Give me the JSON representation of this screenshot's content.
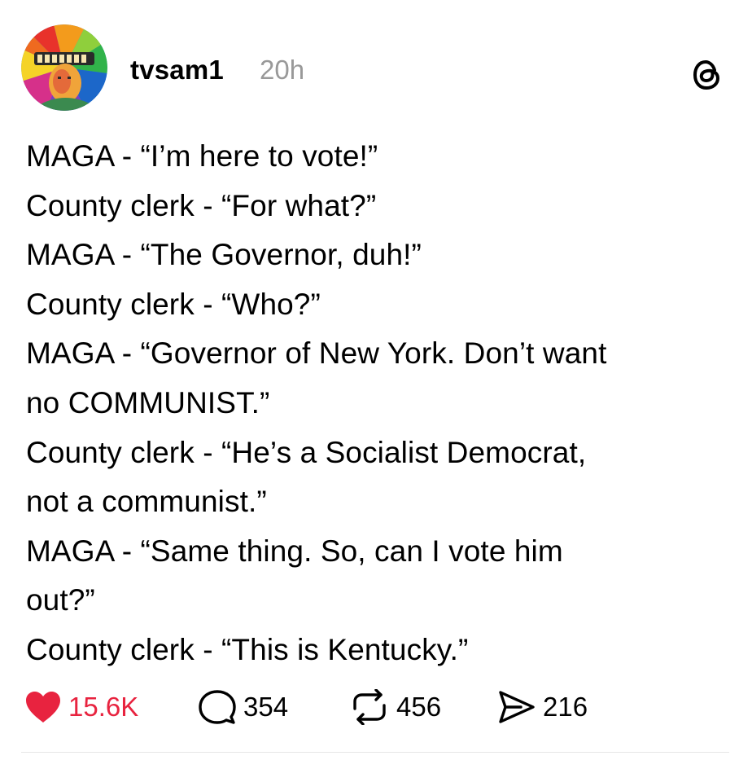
{
  "post": {
    "username": "tvsam1",
    "timestamp": "20h",
    "lines": [
      "MAGA - “I’m here to vote!”",
      "County clerk - “For what?”",
      "MAGA - “The Governor, duh!”",
      "County clerk - “Who?”",
      "MAGA - “Governor of New York. Don’t want",
      "no COMMUNIST.”",
      "County clerk - “He’s a Socialist Democrat,",
      "not a communist.”",
      "MAGA - “Same thing. So, can I vote him",
      "out?”",
      "County clerk - “This is Kentucky.”"
    ]
  },
  "actions": {
    "likes": "15.6K",
    "replies": "354",
    "reposts": "456",
    "shares": "216"
  },
  "icons": {
    "like": "heart-icon",
    "reply": "comment-bubble-icon",
    "repost": "repost-icon",
    "share": "send-icon",
    "brand": "threads-logo-icon"
  },
  "colors": {
    "like": "#e8233f",
    "timestamp": "#999999",
    "text": "#000000"
  }
}
